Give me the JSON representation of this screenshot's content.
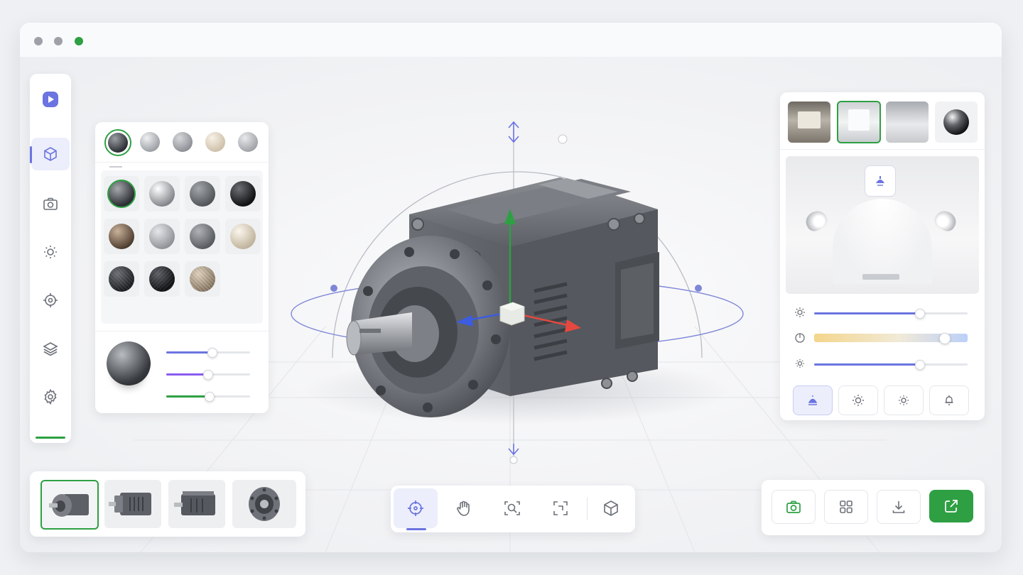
{
  "window": {
    "controls": [
      "close-dot",
      "minimize-dot",
      "maximize-dot"
    ],
    "colors": {
      "close": "#9ea1a8",
      "minimize": "#9ea1a8",
      "maximize": "#2ea043"
    }
  },
  "sidebar": {
    "logo": "play-logo-icon",
    "items": [
      {
        "icon": "cube-icon",
        "active": true
      },
      {
        "icon": "camera-icon",
        "active": false
      },
      {
        "icon": "sun-icon",
        "active": false
      },
      {
        "icon": "target-icon",
        "active": false
      },
      {
        "icon": "layers-icon",
        "active": false
      },
      {
        "icon": "gear-icon",
        "active": false
      }
    ]
  },
  "materials": {
    "top_swatches": [
      "dark-steel",
      "silver",
      "grey",
      "cream",
      "light-grey"
    ],
    "selected_top": 0,
    "grid": [
      "dark-chrome",
      "chrome",
      "rough-grey",
      "black",
      "bronze",
      "brushed-silver",
      "graphite",
      "ivory",
      "carbon-fiber",
      "black-carbon",
      "woven-beige"
    ],
    "selected_grid": 0,
    "preview_sliders": [
      {
        "color": "#6b74e0",
        "value": 0.6
      },
      {
        "color": "#8a5cf0",
        "value": 0.5
      },
      {
        "color": "#2ea043",
        "value": 0.5
      }
    ]
  },
  "environment": {
    "presets": [
      "hall-environment",
      "studio-environment",
      "softbox-environment",
      "chrome-ball"
    ],
    "selected": 1,
    "lights": [
      {
        "icon": "sun-icon",
        "color": "#6b74e0",
        "value": 0.68
      },
      {
        "icon": "temperature-icon",
        "gradient": [
          "#f4d58c",
          "#bcd0f8"
        ],
        "value": 0.83
      },
      {
        "icon": "sun-small-icon",
        "color": "#6b74e0",
        "value": 0.68
      }
    ],
    "light_types": [
      "spot-light-icon",
      "sun-light-icon",
      "point-light-icon",
      "bell-light-icon"
    ],
    "selected_light_type": 0
  },
  "thumbnails": {
    "views": [
      "motor-view-front-left",
      "motor-view-side",
      "motor-view-top-side",
      "motor-view-front"
    ],
    "selected": 0
  },
  "toolbar": {
    "tools": [
      "orbit-icon",
      "pan-hand-icon",
      "zoom-search-icon",
      "frame-fit-icon",
      "cube-view-icon"
    ],
    "selected": 0
  },
  "actions": {
    "buttons": [
      "screenshot-camera-icon",
      "grid-icon",
      "download-icon",
      "share-export-icon"
    ],
    "accent": "#2ea043"
  },
  "colors": {
    "accent_purple": "#6b74e0",
    "accent_green": "#2ea043",
    "axis_y": "#2ea043",
    "axis_x": "#e5483f",
    "axis_z": "#3d5ce0"
  }
}
